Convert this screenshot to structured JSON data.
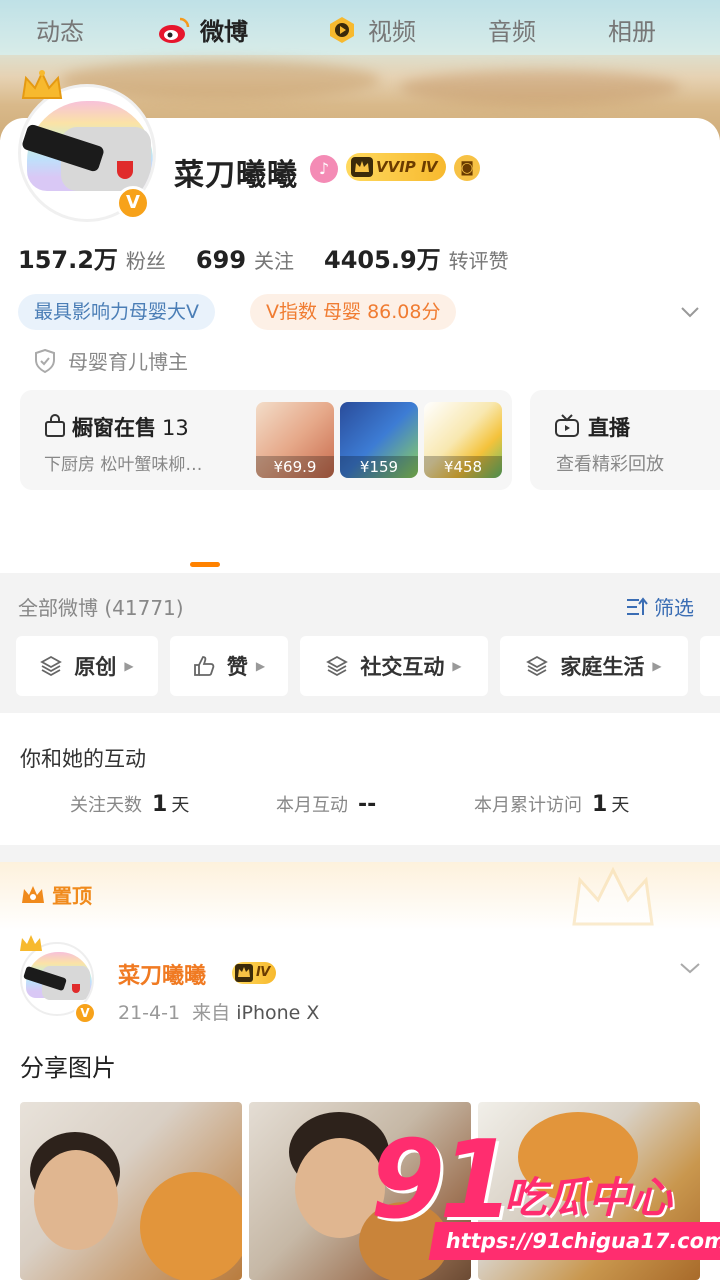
{
  "profile": {
    "name": "菜刀曦曦",
    "vip_badge": "VVIP Ⅳ",
    "stats": [
      {
        "num": "157.2万",
        "label": "粉丝"
      },
      {
        "num": "699",
        "label": "关注"
      },
      {
        "num": "4405.9万",
        "label": "转评赞"
      }
    ],
    "tag_influence": "最具影响力母婴大V",
    "tag_vindex": "V指数 母婴 86.08分",
    "role": "母婴育儿博主"
  },
  "shop": {
    "title": "橱窗在售",
    "count": "13",
    "subtitle": "下厨房 松叶蟹味柳…",
    "prices": [
      "¥69.9",
      "¥159",
      "¥458"
    ]
  },
  "live": {
    "title": "直播",
    "subtitle": "查看精彩回放"
  },
  "tabs": [
    "动态",
    "微博",
    "视频",
    "音频",
    "相册"
  ],
  "feed": {
    "all_label": "全部微博 (41771)",
    "filter_label": "筛选",
    "chips": [
      "原创",
      "赞",
      "社交互动",
      "家庭生活"
    ]
  },
  "interaction": {
    "title": "你和她的互动",
    "items": [
      {
        "key": "关注天数",
        "value": "1",
        "unit": "天"
      },
      {
        "key": "本月互动",
        "value": "--",
        "unit": ""
      },
      {
        "key": "本月累计访问",
        "value": "1",
        "unit": "天"
      }
    ]
  },
  "post": {
    "pinned_label": "置顶",
    "author": "菜刀曦曦",
    "badge": "Ⅳ",
    "date": "21-4-1",
    "from": "来自",
    "source": "iPhone X",
    "text": "分享图片"
  },
  "watermark": {
    "num": "91",
    "name": "吃瓜中心",
    "url": "https://91chigua17.com"
  },
  "colors": {
    "accent": "#ff8200",
    "link": "#3a6db4",
    "vip_gold": "#f7b92e",
    "author_orange": "#f07a22",
    "watermark_pink": "#ff2d6f"
  }
}
